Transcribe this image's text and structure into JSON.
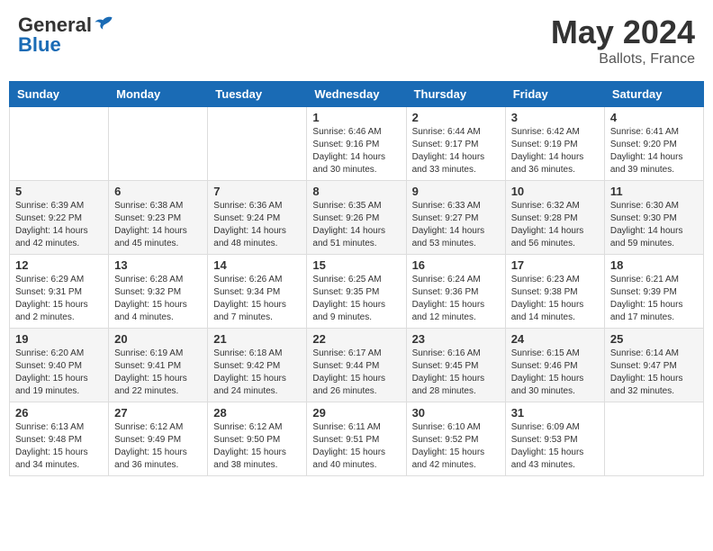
{
  "header": {
    "logo_general": "General",
    "logo_blue": "Blue",
    "month_year": "May 2024",
    "location": "Ballots, France"
  },
  "weekdays": [
    "Sunday",
    "Monday",
    "Tuesday",
    "Wednesday",
    "Thursday",
    "Friday",
    "Saturday"
  ],
  "weeks": [
    [
      {
        "day": "",
        "info": ""
      },
      {
        "day": "",
        "info": ""
      },
      {
        "day": "",
        "info": ""
      },
      {
        "day": "1",
        "info": "Sunrise: 6:46 AM\nSunset: 9:16 PM\nDaylight: 14 hours\nand 30 minutes."
      },
      {
        "day": "2",
        "info": "Sunrise: 6:44 AM\nSunset: 9:17 PM\nDaylight: 14 hours\nand 33 minutes."
      },
      {
        "day": "3",
        "info": "Sunrise: 6:42 AM\nSunset: 9:19 PM\nDaylight: 14 hours\nand 36 minutes."
      },
      {
        "day": "4",
        "info": "Sunrise: 6:41 AM\nSunset: 9:20 PM\nDaylight: 14 hours\nand 39 minutes."
      }
    ],
    [
      {
        "day": "5",
        "info": "Sunrise: 6:39 AM\nSunset: 9:22 PM\nDaylight: 14 hours\nand 42 minutes."
      },
      {
        "day": "6",
        "info": "Sunrise: 6:38 AM\nSunset: 9:23 PM\nDaylight: 14 hours\nand 45 minutes."
      },
      {
        "day": "7",
        "info": "Sunrise: 6:36 AM\nSunset: 9:24 PM\nDaylight: 14 hours\nand 48 minutes."
      },
      {
        "day": "8",
        "info": "Sunrise: 6:35 AM\nSunset: 9:26 PM\nDaylight: 14 hours\nand 51 minutes."
      },
      {
        "day": "9",
        "info": "Sunrise: 6:33 AM\nSunset: 9:27 PM\nDaylight: 14 hours\nand 53 minutes."
      },
      {
        "day": "10",
        "info": "Sunrise: 6:32 AM\nSunset: 9:28 PM\nDaylight: 14 hours\nand 56 minutes."
      },
      {
        "day": "11",
        "info": "Sunrise: 6:30 AM\nSunset: 9:30 PM\nDaylight: 14 hours\nand 59 minutes."
      }
    ],
    [
      {
        "day": "12",
        "info": "Sunrise: 6:29 AM\nSunset: 9:31 PM\nDaylight: 15 hours\nand 2 minutes."
      },
      {
        "day": "13",
        "info": "Sunrise: 6:28 AM\nSunset: 9:32 PM\nDaylight: 15 hours\nand 4 minutes."
      },
      {
        "day": "14",
        "info": "Sunrise: 6:26 AM\nSunset: 9:34 PM\nDaylight: 15 hours\nand 7 minutes."
      },
      {
        "day": "15",
        "info": "Sunrise: 6:25 AM\nSunset: 9:35 PM\nDaylight: 15 hours\nand 9 minutes."
      },
      {
        "day": "16",
        "info": "Sunrise: 6:24 AM\nSunset: 9:36 PM\nDaylight: 15 hours\nand 12 minutes."
      },
      {
        "day": "17",
        "info": "Sunrise: 6:23 AM\nSunset: 9:38 PM\nDaylight: 15 hours\nand 14 minutes."
      },
      {
        "day": "18",
        "info": "Sunrise: 6:21 AM\nSunset: 9:39 PM\nDaylight: 15 hours\nand 17 minutes."
      }
    ],
    [
      {
        "day": "19",
        "info": "Sunrise: 6:20 AM\nSunset: 9:40 PM\nDaylight: 15 hours\nand 19 minutes."
      },
      {
        "day": "20",
        "info": "Sunrise: 6:19 AM\nSunset: 9:41 PM\nDaylight: 15 hours\nand 22 minutes."
      },
      {
        "day": "21",
        "info": "Sunrise: 6:18 AM\nSunset: 9:42 PM\nDaylight: 15 hours\nand 24 minutes."
      },
      {
        "day": "22",
        "info": "Sunrise: 6:17 AM\nSunset: 9:44 PM\nDaylight: 15 hours\nand 26 minutes."
      },
      {
        "day": "23",
        "info": "Sunrise: 6:16 AM\nSunset: 9:45 PM\nDaylight: 15 hours\nand 28 minutes."
      },
      {
        "day": "24",
        "info": "Sunrise: 6:15 AM\nSunset: 9:46 PM\nDaylight: 15 hours\nand 30 minutes."
      },
      {
        "day": "25",
        "info": "Sunrise: 6:14 AM\nSunset: 9:47 PM\nDaylight: 15 hours\nand 32 minutes."
      }
    ],
    [
      {
        "day": "26",
        "info": "Sunrise: 6:13 AM\nSunset: 9:48 PM\nDaylight: 15 hours\nand 34 minutes."
      },
      {
        "day": "27",
        "info": "Sunrise: 6:12 AM\nSunset: 9:49 PM\nDaylight: 15 hours\nand 36 minutes."
      },
      {
        "day": "28",
        "info": "Sunrise: 6:12 AM\nSunset: 9:50 PM\nDaylight: 15 hours\nand 38 minutes."
      },
      {
        "day": "29",
        "info": "Sunrise: 6:11 AM\nSunset: 9:51 PM\nDaylight: 15 hours\nand 40 minutes."
      },
      {
        "day": "30",
        "info": "Sunrise: 6:10 AM\nSunset: 9:52 PM\nDaylight: 15 hours\nand 42 minutes."
      },
      {
        "day": "31",
        "info": "Sunrise: 6:09 AM\nSunset: 9:53 PM\nDaylight: 15 hours\nand 43 minutes."
      },
      {
        "day": "",
        "info": ""
      }
    ]
  ]
}
